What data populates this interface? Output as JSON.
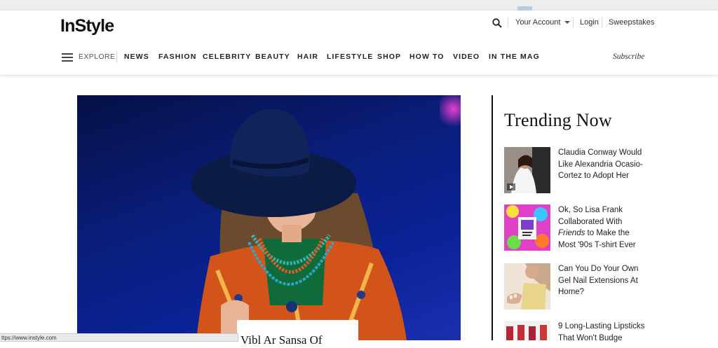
{
  "header": {
    "logo": "InStyle",
    "account_label": "Your Account",
    "login_label": "Login",
    "sweepstakes_label": "Sweepstakes",
    "explore_label": "EXPLORE",
    "subscribe_label": "Subscribe",
    "nav": [
      "NEWS",
      "FASHION",
      "CELEBRITY",
      "BEAUTY",
      "HAIR",
      "LIFESTYLE",
      "SHOP",
      "HOW TO",
      "VIDEO",
      "IN THE MAG"
    ]
  },
  "hero": {
    "caption_partial": "Vibl Ar Sansa Of"
  },
  "status_bar": {
    "url": "ttps://www.instyle.com"
  },
  "trending": {
    "title": "Trending Now",
    "items": [
      {
        "title_lines": [
          "Claudia Conway Would",
          "Like Alexandria Ocasio-",
          "Cortez to Adopt Her"
        ],
        "thumb": "wedding-photo"
      },
      {
        "title_lines": [
          "Ok, So Lisa Frank",
          "Collaborated With"
        ],
        "title_em": "Friends",
        "title_after": " to Make the",
        "title_last": "Most '90s T-shirt Ever",
        "thumb": "lisa-frank-shirt"
      },
      {
        "title_lines": [
          "Can You Do Your Own",
          "Gel Nail Extensions At",
          "Home?"
        ],
        "thumb": "nail-extensions"
      },
      {
        "title_lines": [
          "9 Long-Lasting Lipsticks",
          "That Won't Budge"
        ],
        "thumb": "lipsticks"
      }
    ]
  },
  "colors": {
    "accent": "#111111",
    "hero_bg": "#0a1d7a"
  }
}
